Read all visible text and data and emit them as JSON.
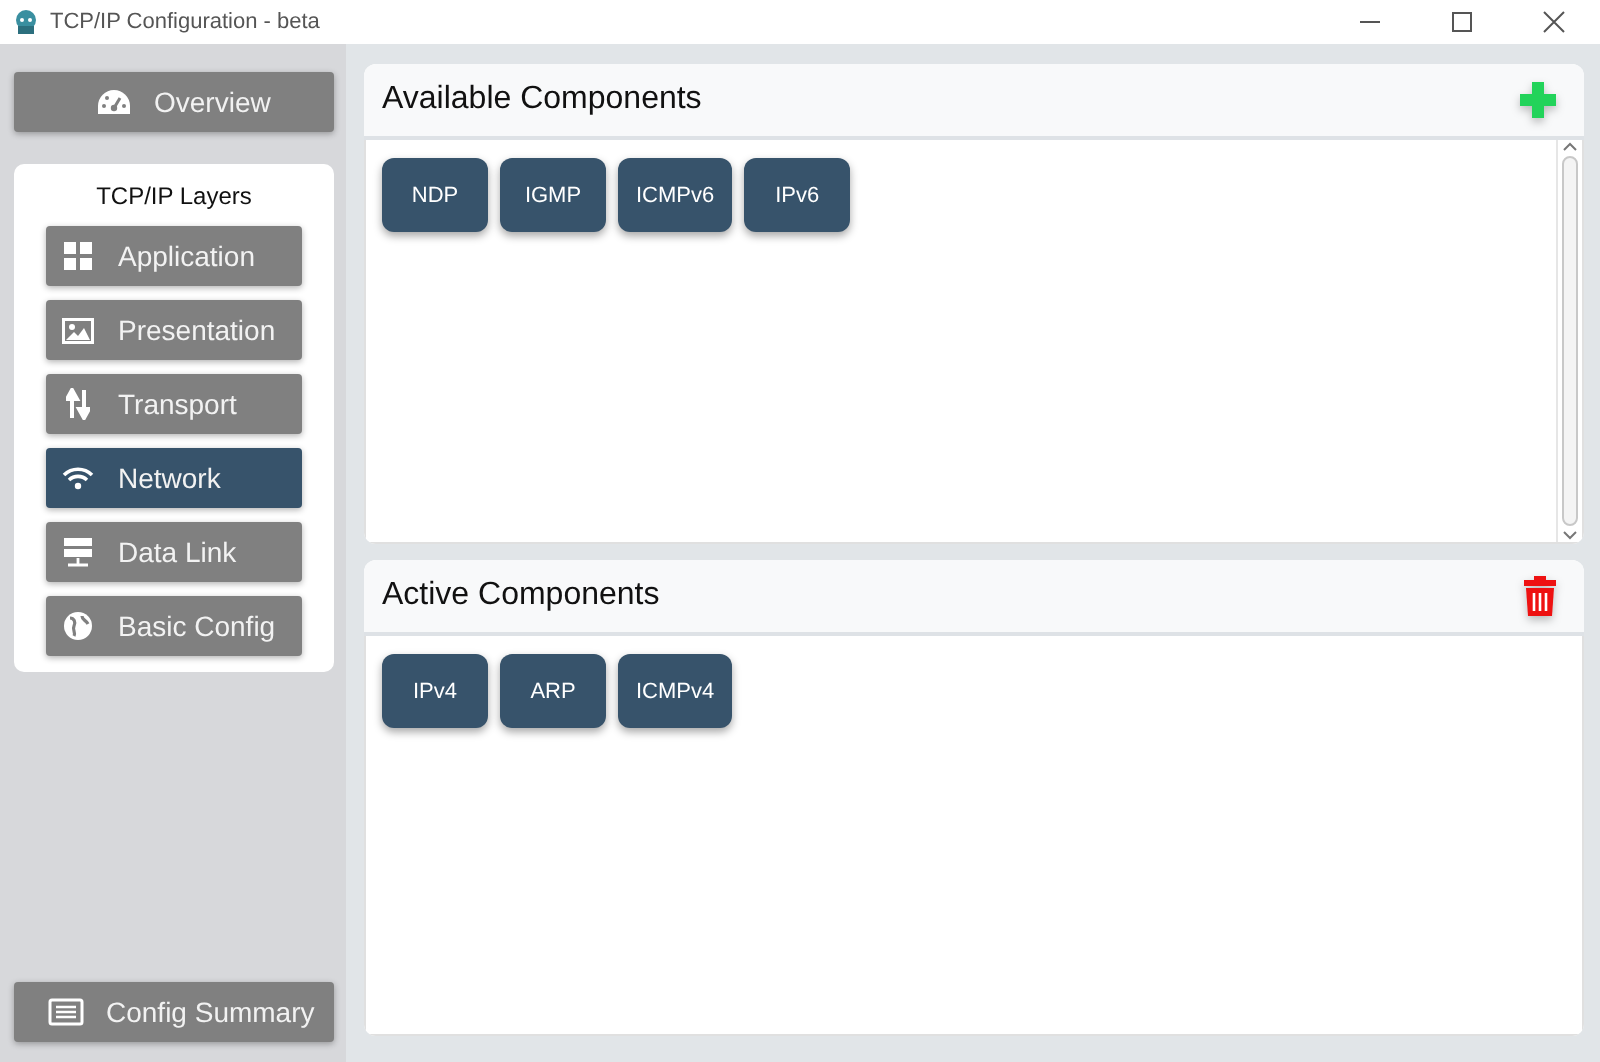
{
  "window": {
    "title": "TCP/IP Configuration - beta"
  },
  "sidebar": {
    "overview": "Overview",
    "layers_title": "TCP/IP Layers",
    "layers": [
      {
        "label": "Application",
        "selected": false
      },
      {
        "label": "Presentation",
        "selected": false
      },
      {
        "label": "Transport",
        "selected": false
      },
      {
        "label": "Network",
        "selected": true
      },
      {
        "label": "Data Link",
        "selected": false
      },
      {
        "label": "Basic Config",
        "selected": false
      }
    ],
    "summary": "Config Summary"
  },
  "panels": [
    {
      "title": "Available Components",
      "components": [
        "NDP",
        "IGMP",
        "ICMPv6",
        "IPv6"
      ]
    },
    {
      "title": "Active Components",
      "components": [
        "IPv4",
        "ARP",
        "ICMPv4"
      ]
    }
  ]
}
